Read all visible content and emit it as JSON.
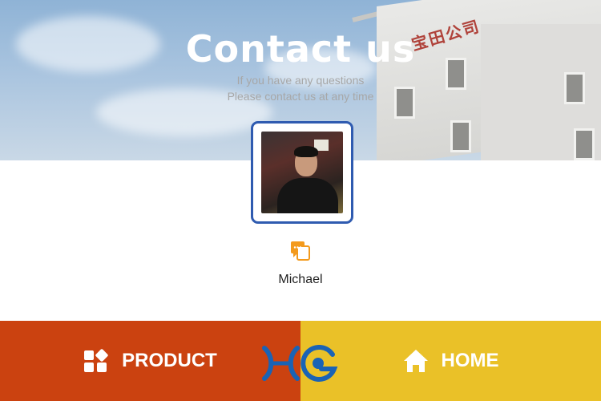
{
  "hero": {
    "title": "Contact us",
    "subtitle_line1": "If you have any questions",
    "subtitle_line2": "Please contact us at any time",
    "building_sign": "宝田公司"
  },
  "contact": {
    "name": "Michael",
    "icon": "chat-icon"
  },
  "bottom_nav": {
    "product_label": "PRODUCT",
    "product_icon": "apps-icon",
    "home_label": "HOME",
    "home_icon": "home-icon",
    "logo": "hg-logo"
  },
  "colors": {
    "product_bg": "#cb4210",
    "home_bg": "#eac128",
    "avatar_border": "#2f5bb0",
    "chat_icon": "#f39a1d",
    "logo_blue": "#1a63b5"
  }
}
